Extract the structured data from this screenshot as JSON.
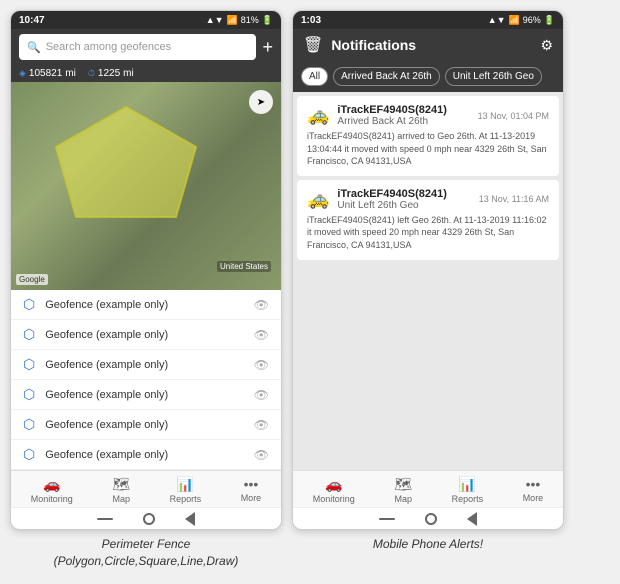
{
  "left_phone": {
    "status_bar": {
      "time": "10:47",
      "signal": "▲▼",
      "wifi": "WiFi",
      "battery": "81%"
    },
    "search": {
      "placeholder": "Search among geofences"
    },
    "stats": {
      "odometer_label": "105821",
      "odometer_unit": "mi",
      "timer_label": "1225",
      "timer_unit": "mi"
    },
    "geofences": [
      {
        "label": "Geofence (example only)"
      },
      {
        "label": "Geofence (example only)"
      },
      {
        "label": "Geofence (example only)"
      },
      {
        "label": "Geofence (example only)"
      },
      {
        "label": "Geofence (example only)"
      },
      {
        "label": "Geofence (example only)"
      }
    ],
    "nav": [
      {
        "icon": "🚗",
        "label": "Monitoring",
        "active": false
      },
      {
        "icon": "🗺",
        "label": "Map",
        "active": false
      },
      {
        "icon": "📊",
        "label": "Reports",
        "active": false
      },
      {
        "icon": "•••",
        "label": "More",
        "active": false
      }
    ],
    "caption": "Perimeter Fence\n(Polygon,Circle,Square,Line,Draw)"
  },
  "right_phone": {
    "status_bar": {
      "time": "1:03",
      "battery": "96%"
    },
    "header": {
      "title": "Notifications",
      "trash_icon": "🗑",
      "gear_icon": "⚙"
    },
    "filters": [
      {
        "label": "All",
        "active": true
      },
      {
        "label": "Arrived Back At 26th",
        "active": false
      },
      {
        "label": "Unit Left 26th Geo",
        "active": false
      }
    ],
    "notifications": [
      {
        "device": "iTrackEF4940S(8241)",
        "event": "Arrived Back At 26th",
        "time": "13 Nov, 01:04 PM",
        "description": "iTrackEF4940S(8241) arrived to Geo 26th.  At 11-13-2019 13:04:44 it moved with speed 0 mph near 4329 26th St, San Francisco, CA 94131,USA"
      },
      {
        "device": "iTrackEF4940S(8241)",
        "event": "Unit Left 26th Geo",
        "time": "13 Nov, 11:16 AM",
        "description": "iTrackEF4940S(8241) left Geo 26th.  At 11-13-2019 11:16:02 it moved with speed 20 mph near 4329 26th St, San Francisco, CA 94131,USA"
      }
    ],
    "nav": [
      {
        "icon": "🚗",
        "label": "Monitoring",
        "active": false
      },
      {
        "icon": "🗺",
        "label": "Map",
        "active": false
      },
      {
        "icon": "📊",
        "label": "Reports",
        "active": false
      },
      {
        "icon": "•••",
        "label": "More",
        "active": false
      }
    ],
    "caption": "Mobile Phone Alerts!"
  }
}
